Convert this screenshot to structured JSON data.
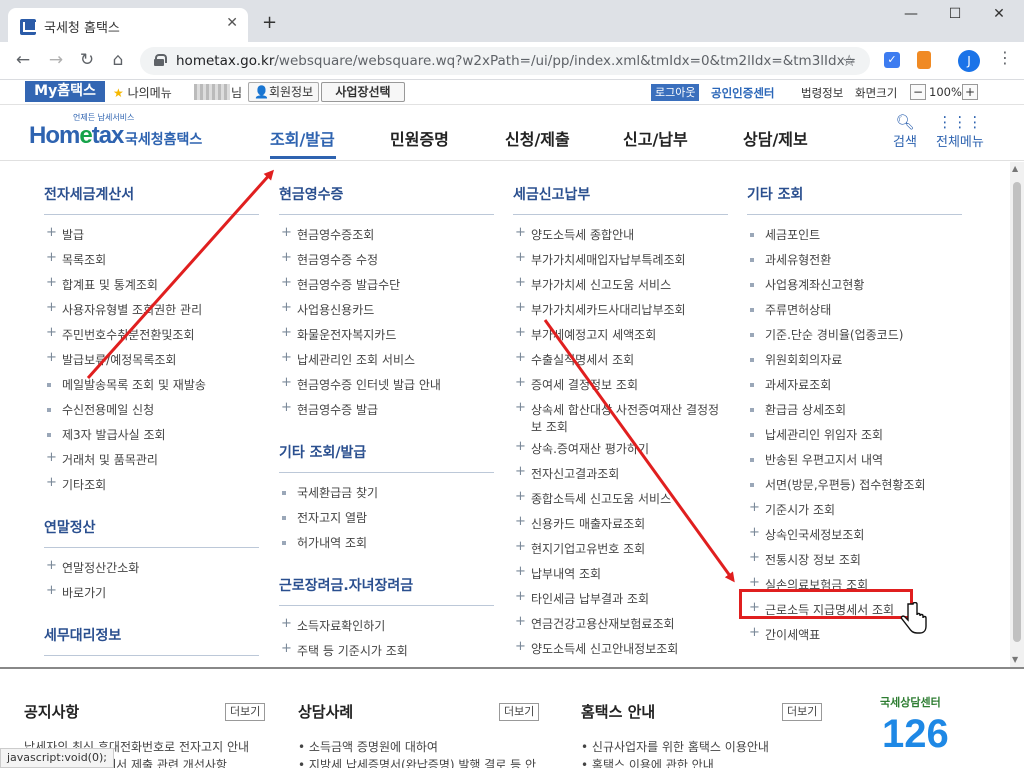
{
  "browser": {
    "tab_title": "국세청 홈택스",
    "tab_close": "✕",
    "new_tab": "+",
    "url_host": "hometax.go.kr",
    "url_path": "/websquare/websquare.wq?w2xPath=/ui/pp/index.xml&tmIdx=0&tm2lIdx=&tm3lIdx=",
    "profile_initial": "J",
    "status_text": "javascript:void(0);"
  },
  "util": {
    "my_hometax": "My홈택스",
    "my_menu": "나의메뉴",
    "name_suffix": "님",
    "member_info": "회원정보",
    "business_select": "사업장선택",
    "logout": "로그아웃",
    "cert_center": "공인인증센터",
    "law_info": "법령정보",
    "screen_size": "화면크기",
    "zoom_minus": "−",
    "zoom_level": "100%",
    "zoom_plus": "+"
  },
  "gnb": {
    "logo_small": "언제든 납세서비스",
    "logo_text_pre": "Hom",
    "logo_text_e": "e",
    "logo_text_post": "tax",
    "logo_kor": "국세청홈택스",
    "menus": [
      "조회/발급",
      "민원증명",
      "신청/제출",
      "신고/납부",
      "상담/제보"
    ],
    "search": "검색",
    "all_menu": "전체메뉴"
  },
  "columns": {
    "col1": {
      "sections": [
        {
          "title": "전자세금계산서",
          "items": [
            "발급",
            "목록조회",
            "합계표 및 통계조회",
            "사용자유형별 조회권한 관리",
            "주민번호수취분전환및조회",
            "발급보류/예정목록조회",
            "메일발송목록 조회 및 재발송",
            "수신전용메일 신청",
            "제3자 발급사실 조회",
            "거래처 및 품목관리",
            "기타조회"
          ]
        },
        {
          "title": "연말정산",
          "items": [
            "연말정산간소화",
            "바로가기"
          ]
        },
        {
          "title": "세무대리정보",
          "items": []
        }
      ]
    },
    "col2": {
      "sections": [
        {
          "title": "현금영수증",
          "items": [
            "현금영수증조회",
            "현금영수증 수정",
            "현금영수증 발급수단",
            "사업용신용카드",
            "화물운전자복지카드",
            "납세관리인 조회 서비스",
            "현금영수증 인터넷 발급 안내",
            "현금영수증 발급"
          ]
        },
        {
          "title": "기타 조회/발급",
          "items": [
            "국세환급금 찾기",
            "전자고지 열람",
            "허가내역 조회"
          ]
        },
        {
          "title": "근로장려금.자녀장려금",
          "items": [
            "소득자료확인하기",
            "주택 등 기준시가 조회"
          ]
        }
      ]
    },
    "col3": {
      "sections": [
        {
          "title": "세금신고납부",
          "items": [
            "양도소득세 종합안내",
            "부가가치세매입자납부특례조회",
            "부가가치세 신고도움 서비스",
            "부가가치세카드사대리납부조회",
            "부가세예정고지 세액조회",
            "수출실적명세서 조회",
            "증여세 결정정보 조회",
            "상속세 합산대상 사전증여재산 결정정보 조회",
            "상속.증여재산 평가하기",
            "전자신고결과조회",
            "종합소득세 신고도움 서비스",
            "신용카드 매출자료조회",
            "현지기업고유번호 조회",
            "납부내역 조회",
            "타인세금 납부결과 조회",
            "연금건강고용산재보험료조회",
            "양도소득세 신고안내정보조회"
          ]
        }
      ]
    },
    "col4": {
      "sections": [
        {
          "title": "기타 조회",
          "items": [
            "세금포인트",
            "과세유형전환",
            "사업용계좌신고현황",
            "주류면허상태",
            "기준.단순 경비율(업종코드)",
            "위원회회의자료",
            "과세자료조회",
            "환급금 상세조회",
            "납세관리인 위임자 조회",
            "반송된 우편고지서 내역",
            "서면(방문,우편등) 접수현황조회",
            "기준시가 조회",
            "상속인국세정보조회",
            "전통시장 정보 조회",
            "실손의료보험금 조회",
            "근로소득 지급명세서 조회",
            "간이세액표"
          ]
        }
      ]
    }
  },
  "footer": {
    "more": "더보기",
    "notice": {
      "title": "공지사항",
      "items": [
        "납세자의 최신 휴대전화번호로 전자고지 안내",
        "근로소득 지급명세서 제출 관련 개선사항"
      ]
    },
    "counsel": {
      "title": "상담사례",
      "items": [
        "소득금액 증명원에 대하여",
        "지방세 납세증명서(완납증명) 발행 결로 등 안"
      ]
    },
    "guide": {
      "title": "홈택스 안내",
      "items": [
        "신규사업자를 위한 홈택스 이용안내",
        "홈택스 이용에 관한 안내"
      ]
    },
    "center": {
      "title": "국세상담센터",
      "number": "126"
    }
  },
  "colors": {
    "brand": "#2e63b0",
    "annotation": "#e01f1f"
  }
}
